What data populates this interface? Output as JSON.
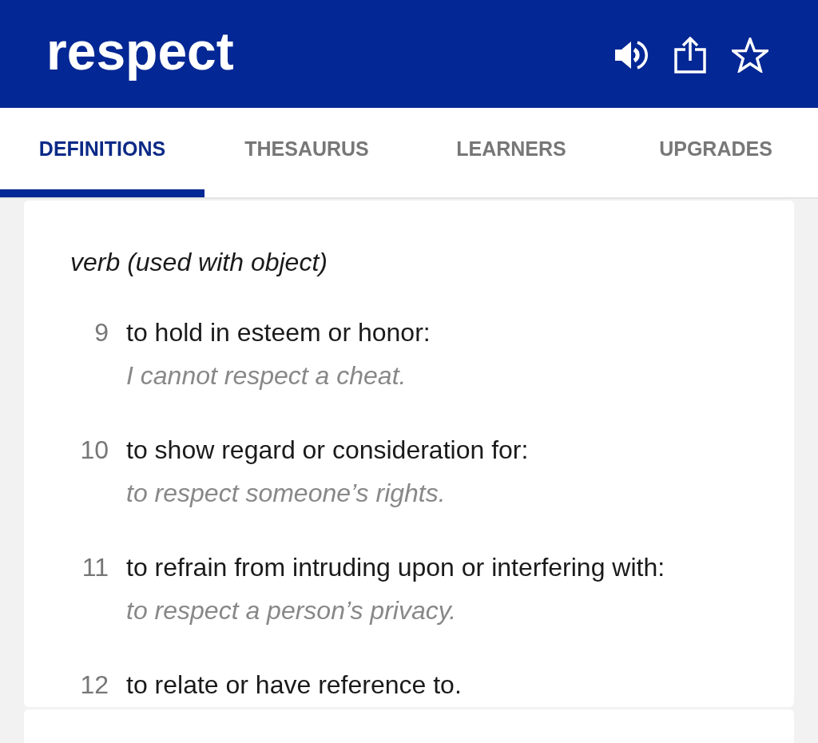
{
  "header": {
    "title": "respect"
  },
  "tabs": [
    {
      "label": "DEFINITIONS",
      "selected": true
    },
    {
      "label": "THESAURUS",
      "selected": false
    },
    {
      "label": "LEARNERS",
      "selected": false
    },
    {
      "label": "UPGRADES",
      "selected": false
    }
  ],
  "entry": {
    "part_of_speech": "verb (used with object)",
    "definitions": [
      {
        "number": "9",
        "text": "to hold in esteem or honor:",
        "example": "I cannot respect a cheat."
      },
      {
        "number": "10",
        "text": "to show regard or consideration for:",
        "example": "to respect someone’s rights."
      },
      {
        "number": "11",
        "text": "to refrain from intruding upon or interfering with:",
        "example": "to respect a person’s privacy."
      },
      {
        "number": "12",
        "text": "to relate or have reference to."
      }
    ]
  }
}
